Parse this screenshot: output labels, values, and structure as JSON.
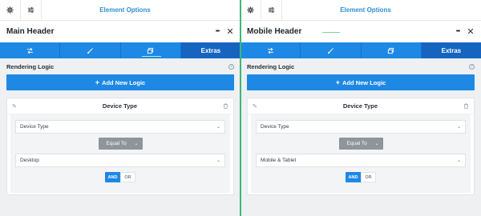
{
  "panels": [
    {
      "topbar_title": "Element Options",
      "header_title": "Main Header",
      "more_icon_label": "•••",
      "close_icon_label": "✕",
      "tabs": [
        {
          "icon": "arrows-icon",
          "label": ""
        },
        {
          "icon": "brush-icon",
          "label": ""
        },
        {
          "icon": "layers-icon",
          "label": ""
        },
        {
          "icon": "",
          "label": "Extras"
        }
      ],
      "section_title": "Rendering Logic",
      "add_button_label": "+ Add New Logic",
      "add_button_text": "Add New Logic",
      "card_title": "Device Type",
      "condition_field": "Device Type",
      "operator": "Equal To",
      "condition_value": "Desktop",
      "logic_and": "AND",
      "logic_or": "OR"
    },
    {
      "topbar_title": "Element Options",
      "header_title": "Mobile Header",
      "more_icon_label": "•••",
      "close_icon_label": "✕",
      "tabs": [
        {
          "icon": "arrows-icon",
          "label": ""
        },
        {
          "icon": "brush-icon",
          "label": ""
        },
        {
          "icon": "layers-icon",
          "label": ""
        },
        {
          "icon": "",
          "label": "Extras"
        }
      ],
      "section_title": "Rendering Logic",
      "add_button_label": "+ Add New Logic",
      "add_button_text": "Add New Logic",
      "card_title": "Device Type",
      "condition_field": "Device Type",
      "operator": "Equal To",
      "condition_value": "Mobile & Tablet",
      "logic_and": "AND",
      "logic_or": "OR"
    }
  ],
  "colors": {
    "accent": "#1e88e5",
    "accent_dark": "#1565c0",
    "divider": "#3cb878",
    "operator_bg": "#8e959b"
  }
}
